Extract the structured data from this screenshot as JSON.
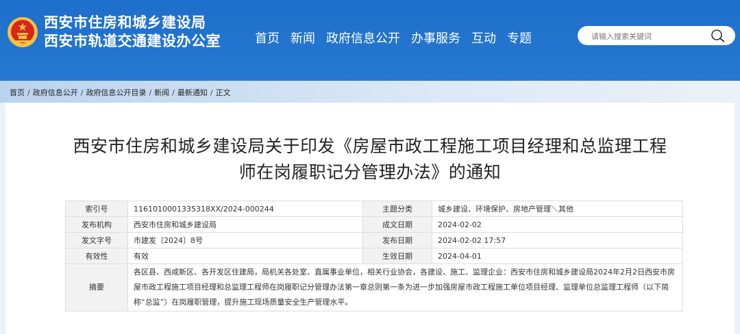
{
  "header": {
    "title_line1": "西安市住房和城乡建设局",
    "title_line2": "西安市轨道交通建设办公室",
    "nav": [
      "首页",
      "新闻",
      "政府信息公开",
      "办事服务",
      "互动",
      "专题"
    ],
    "search_placeholder": "请输入搜索关键词"
  },
  "breadcrumb": [
    "首页",
    "政府信息公开",
    "政府信息公开目录",
    "新闻",
    "最新通知",
    "正文"
  ],
  "article": {
    "title_line1": "西安市住房和城乡建设局关于印发《房屋市政工程施工项目经理和总监理工程",
    "title_line2": "师在岗履职记分管理办法》的通知"
  },
  "meta": {
    "index_label": "索引号",
    "index_value": "1161010001335318XX/2024-000244",
    "topic_label": "主题分类",
    "topic_value": "城乡建设、环境保护、房地产管理＼其他",
    "issuer_label": "发布机构",
    "issuer_value": "西安市住房和城乡建设局",
    "created_label": "成文日期",
    "created_value": "2024-02-02",
    "docno_label": "发文字号",
    "docno_value": "市建发〔2024〕8号",
    "published_label": "发布日期",
    "published_value": "2024-02-02 17:57",
    "validity_label": "有效性",
    "validity_value": "有效",
    "effective_label": "生效日期",
    "effective_value": "2024-04-01",
    "abstract_label": "摘要",
    "abstract_value": "各区县、西咸新区、各开发区住建局，局机关各处室、直属事业单位，相关行业协会，各建设、施工、监理企业：西安市住房和城乡建设局2024年2月2日西安市房屋市政工程施工项目经理和总监理工程师在岗履职记分管理办法第一章总则第一条为进一步加强房屋市政工程施工单位项目经理、监理单位总监理工程师（以下简称“总监”）在岗履职管理，提升施工现场质量安全生产管理水平。"
  },
  "colors": {
    "header_blue": "#1e6fcb",
    "emblem_red": "#d9261c",
    "emblem_gold": "#f5c342"
  }
}
